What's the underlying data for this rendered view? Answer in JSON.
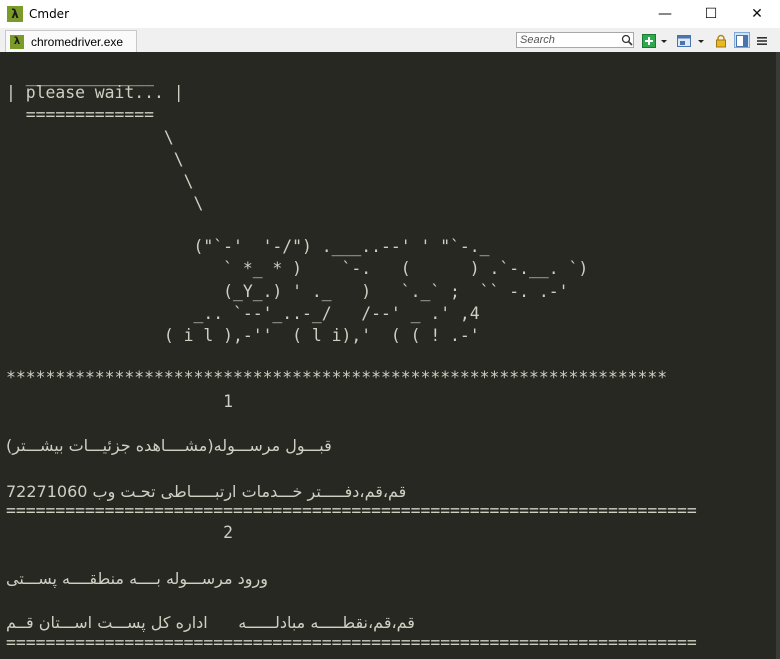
{
  "window": {
    "title": "Cmder",
    "app_icon_glyph": "λ",
    "minimize_glyph": "—",
    "maximize_glyph": "☐",
    "close_glyph": "✕"
  },
  "toolbar": {
    "tab_label": "chromedriver.exe",
    "tab_icon_glyph": "λ",
    "search_placeholder": "Search"
  },
  "console": {
    "lines": [
      "  _____________",
      "| please wait... |",
      "  =============",
      "                \\",
      "                 \\",
      "                  \\",
      "                   \\",
      "                   (\"`-'  '-/\") .___..--' ' \"`-._",
      "                      ` *_ * )    `-.   (      ) .`-.__. `)",
      "                      (_Y_.) ' ._   )   `._` ;  `` -. .-'",
      "                   _.. `--'_..-_/   /--' _ .' ,4",
      "                ( i l ),-''  ( l i),'  ( ( ! .-'",
      "*******************************************************************",
      "                      1",
      "                      2",
      "======================================================================",
      "======================================================================"
    ],
    "persian": {
      "item1_title": "قبـــول مرســـوله(مشــــاهده جزئیـــات بیشـــتر)",
      "item1_detail": "قم،قم،دفـــــتر خـــدمات ارتبـــــاطی تحـت وب 72271060",
      "item2_title": "ورود مرســـوله بــــه منطقــــه پســـتی",
      "item2_detail": "قم،قم،نقطـــــه مبادلــــــه      اداره کل پســـت اســـتان قــم"
    }
  }
}
